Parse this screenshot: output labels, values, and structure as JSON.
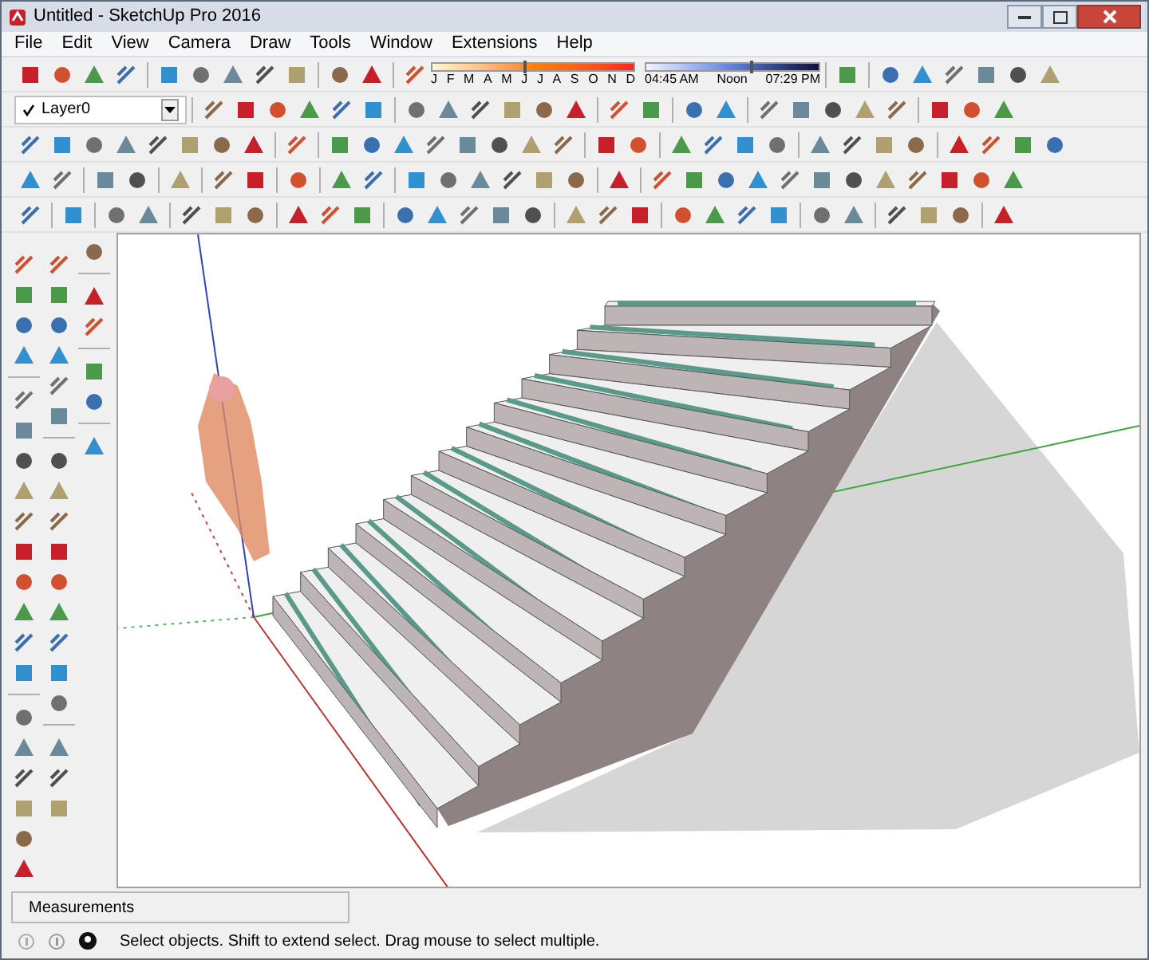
{
  "window": {
    "title": "Untitled - SketchUp Pro 2016"
  },
  "menu": [
    "File",
    "Edit",
    "View",
    "Camera",
    "Draw",
    "Tools",
    "Window",
    "Extensions",
    "Help"
  ],
  "layer": {
    "value": "Layer0",
    "checked": true
  },
  "shadow": {
    "date_slider": {
      "level": 0.45
    },
    "time_slider": {
      "level": 0.6
    },
    "months": [
      "J",
      "F",
      "M",
      "A",
      "M",
      "J",
      "J",
      "A",
      "S",
      "O",
      "N",
      "D"
    ],
    "times": [
      "04:45 AM",
      "Noon",
      "07:29 PM"
    ]
  },
  "measurements": {
    "label": "Measurements"
  },
  "status_bar": {
    "text": "Select objects. Shift to extend select. Drag mouse to select multiple."
  }
}
